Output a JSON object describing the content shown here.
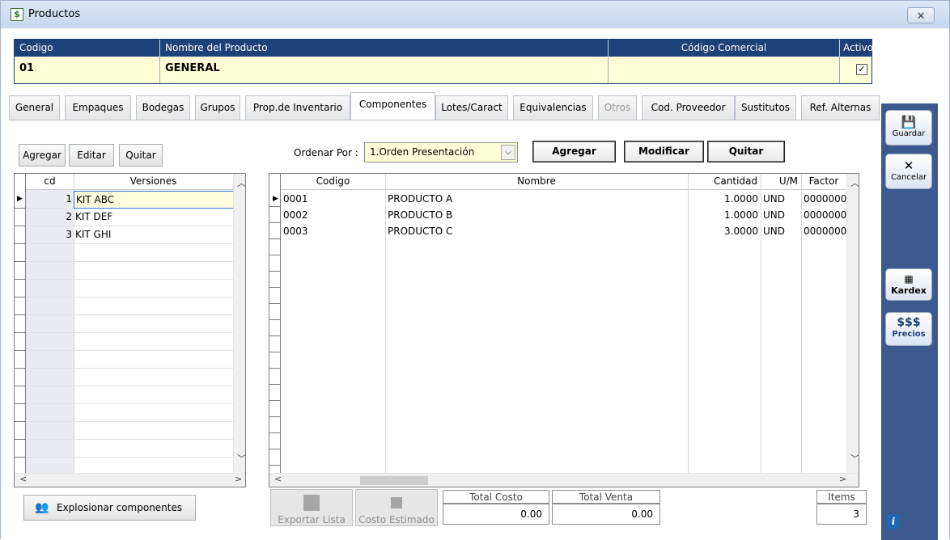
{
  "window": {
    "title": "Productos",
    "close_glyph": "🗙"
  },
  "header": {
    "codigo_label": "Codigo",
    "nombre_label": "Nombre del Producto",
    "comercial_label": "Código Comercial",
    "activo_label": "Activo",
    "codigo_value": "01",
    "nombre_value": "GENERAL",
    "comercial_value": "",
    "activo_checked": true,
    "check_glyph": "✓"
  },
  "tabs": [
    {
      "label": "General",
      "active": false,
      "disabled": false
    },
    {
      "label": "Empaques",
      "active": false,
      "disabled": false
    },
    {
      "label": "Bodegas",
      "active": false,
      "disabled": false
    },
    {
      "label": "Grupos",
      "active": false,
      "disabled": false
    },
    {
      "label": "Prop.de Inventario",
      "active": false,
      "disabled": false
    },
    {
      "label": "Componentes",
      "active": true,
      "disabled": false
    },
    {
      "label": "Lotes/Caract",
      "active": false,
      "disabled": false
    },
    {
      "label": "Equivalencias",
      "active": false,
      "disabled": false
    },
    {
      "label": "Otros",
      "active": false,
      "disabled": true
    },
    {
      "label": "Cod. Proveedor",
      "active": false,
      "disabled": false
    },
    {
      "label": "Sustitutos",
      "active": false,
      "disabled": false
    },
    {
      "label": "Ref. Alternas",
      "active": false,
      "disabled": false
    }
  ],
  "versions_toolbar": {
    "agregar": "Agregar",
    "editar": "Editar",
    "quitar": "Quitar"
  },
  "order": {
    "label": "Ordenar Por :",
    "selected": "1.Orden Presentación"
  },
  "components_toolbar": {
    "agregar": "Agregar",
    "modificar": "Modificar",
    "quitar": "Quitar"
  },
  "versions_grid": {
    "columns": [
      "cd",
      "Versiones"
    ],
    "rows": [
      {
        "cd": "1",
        "name": "KIT ABC"
      },
      {
        "cd": "2",
        "name": "KIT DEF"
      },
      {
        "cd": "3",
        "name": "KIT GHI"
      }
    ]
  },
  "components_grid": {
    "columns": [
      "Codigo",
      "Nombre",
      "Cantidad",
      "U/M",
      "Factor"
    ],
    "rows": [
      {
        "codigo": "0001",
        "nombre": "PRODUCTO A",
        "cantidad": "1.0000",
        "um": "UND",
        "factor": "0000000"
      },
      {
        "codigo": "0002",
        "nombre": "PRODUCTO B",
        "cantidad": "1.0000",
        "um": "UND",
        "factor": "0000000"
      },
      {
        "codigo": "0003",
        "nombre": "PRODUCTO C",
        "cantidad": "3.0000",
        "um": "UND",
        "factor": "0000000"
      }
    ]
  },
  "footer": {
    "explosionar": "Explosionar componentes",
    "exportar": "Exportar Lista",
    "costo_estimado": "Costo Estimado",
    "total_costo_label": "Total Costo",
    "total_venta_label": "Total Venta",
    "total_costo": "0.00",
    "total_venta": "0.00",
    "items_label": "Items",
    "items": "3"
  },
  "side": {
    "guardar": "Guardar",
    "cancelar": "Cancelar",
    "kardex": "Kardex",
    "precios_symbol": "$$$",
    "precios": "Precios",
    "info": "i"
  },
  "icons": {
    "guardar": "floppy-disk-icon",
    "cancelar": "x-icon",
    "kardex": "keyboard-icon",
    "explosionar": "people-icon",
    "app": "document-icon"
  }
}
